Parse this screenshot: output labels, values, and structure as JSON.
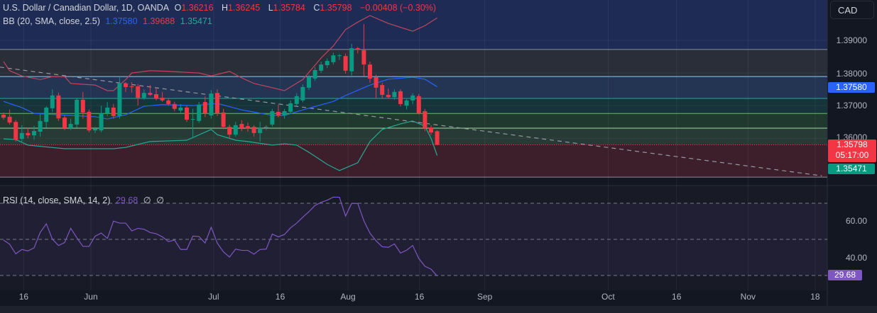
{
  "legend": {
    "symbol": "U.S. Dollar / Canadian Dollar, 1D, OANDA",
    "o_label": "O",
    "o": "1.36216",
    "h_label": "H",
    "h": "1.36245",
    "l_label": "L",
    "l": "1.35784",
    "c_label": "C",
    "c": "1.35798",
    "change": "−0.00408 (−0.30%)",
    "bb_label": "BB (20, SMA, close, 2.5)",
    "bb_basis": "1.37580",
    "bb_upper": "1.39688",
    "bb_lower": "1.35471",
    "rsi_label": "RSI (14, close, SMA, 14, 2)",
    "rsi_value": "29.68",
    "rsi_na1": "∅",
    "rsi_na2": "∅"
  },
  "currency_button": "CAD",
  "price_axis": [
    "1.39000",
    "1.38000",
    "1.37000",
    "1.36000"
  ],
  "rsi_axis": [
    "60.00",
    "40.00"
  ],
  "badges": {
    "basis": "1.37580",
    "last": "1.35798",
    "countdown": "05:17:00",
    "lower": "1.35471",
    "rsi": "29.68"
  },
  "colors": {
    "up": "#089981",
    "down": "#f23645",
    "bb_upper": "#c2455f",
    "bb_basis": "#2962ff",
    "bb_lower": "#22ab94",
    "rsi": "#7e57c2",
    "background": "#131722"
  },
  "chart_data": [
    {
      "type": "candlestick",
      "title": "U.S. Dollar / Canadian Dollar, 1D, OANDA",
      "ylim": [
        1.3455,
        1.3995
      ],
      "grid": true,
      "x_ticks": [
        {
          "label": "16",
          "bar": 3.3
        },
        {
          "label": "Jun",
          "bar": 14.3
        },
        {
          "label": "Jul",
          "bar": 34.4
        },
        {
          "label": "16",
          "bar": 45.3
        },
        {
          "label": "Aug",
          "bar": 56.4
        },
        {
          "label": "16",
          "bar": 68.1
        },
        {
          "label": "Sep",
          "bar": 78.8
        },
        {
          "label": "Oct",
          "bar": 99
        },
        {
          "label": "16",
          "bar": 110.2
        },
        {
          "label": "Nov",
          "bar": 121.9
        },
        {
          "label": "18",
          "bar": 132.9
        }
      ],
      "ohlc": [
        [
          1.3672,
          1.3679,
          1.3657,
          1.3663
        ],
        [
          1.3666,
          1.3688,
          1.3642,
          1.3648
        ],
        [
          1.365,
          1.3656,
          1.359,
          1.3596
        ],
        [
          1.3598,
          1.364,
          1.359,
          1.3616
        ],
        [
          1.3616,
          1.3633,
          1.36,
          1.3609
        ],
        [
          1.3609,
          1.3638,
          1.3596,
          1.3622
        ],
        [
          1.362,
          1.3676,
          1.3605,
          1.3653
        ],
        [
          1.365,
          1.3698,
          1.3632,
          1.3694
        ],
        [
          1.3692,
          1.375,
          1.368,
          1.3731
        ],
        [
          1.3731,
          1.374,
          1.3653,
          1.3661
        ],
        [
          1.3663,
          1.367,
          1.3625,
          1.3631
        ],
        [
          1.3631,
          1.366,
          1.3625,
          1.3644
        ],
        [
          1.3642,
          1.3724,
          1.3632,
          1.3718
        ],
        [
          1.3718,
          1.3742,
          1.366,
          1.3679
        ],
        [
          1.3681,
          1.3688,
          1.3618,
          1.3624
        ],
        [
          1.3624,
          1.3635,
          1.3616,
          1.3629
        ],
        [
          1.3624,
          1.37,
          1.3618,
          1.3676
        ],
        [
          1.3676,
          1.3711,
          1.3668,
          1.3694
        ],
        [
          1.3694,
          1.3705,
          1.366,
          1.3668
        ],
        [
          1.3668,
          1.3789,
          1.366,
          1.3768
        ],
        [
          1.3768,
          1.3772,
          1.3742,
          1.3757
        ],
        [
          1.3759,
          1.3772,
          1.374,
          1.3757
        ],
        [
          1.3759,
          1.3766,
          1.37,
          1.3724
        ],
        [
          1.3724,
          1.375,
          1.3718,
          1.3739
        ],
        [
          1.3739,
          1.3763,
          1.373,
          1.3733
        ],
        [
          1.3735,
          1.3755,
          1.3716,
          1.3722
        ],
        [
          1.3724,
          1.3742,
          1.3712,
          1.3716
        ],
        [
          1.3716,
          1.3722,
          1.37,
          1.3705
        ],
        [
          1.3705,
          1.3712,
          1.3683,
          1.369
        ],
        [
          1.3685,
          1.3705,
          1.3678,
          1.3694
        ],
        [
          1.3694,
          1.37,
          1.365,
          1.3657
        ],
        [
          1.3657,
          1.369,
          1.36,
          1.3659
        ],
        [
          1.3653,
          1.3711,
          1.3647,
          1.3703
        ],
        [
          1.3711,
          1.3728,
          1.3665,
          1.3676
        ],
        [
          1.367,
          1.3748,
          1.366,
          1.3737
        ],
        [
          1.3739,
          1.375,
          1.3668,
          1.3676
        ],
        [
          1.3679,
          1.369,
          1.3628,
          1.3635
        ],
        [
          1.3635,
          1.3642,
          1.36,
          1.3611
        ],
        [
          1.3611,
          1.365,
          1.3605,
          1.364
        ],
        [
          1.3644,
          1.3655,
          1.3622,
          1.3631
        ],
        [
          1.3637,
          1.3648,
          1.362,
          1.3629
        ],
        [
          1.3635,
          1.364,
          1.3605,
          1.3616
        ],
        [
          1.3616,
          1.365,
          1.359,
          1.3631
        ],
        [
          1.3633,
          1.364,
          1.3625,
          1.3635
        ],
        [
          1.3642,
          1.369,
          1.3636,
          1.3683
        ],
        [
          1.3681,
          1.3703,
          1.3664,
          1.367
        ],
        [
          1.367,
          1.369,
          1.366,
          1.3683
        ],
        [
          1.3681,
          1.3716,
          1.3674,
          1.3707
        ],
        [
          1.3705,
          1.3738,
          1.3698,
          1.3729
        ],
        [
          1.3716,
          1.3765,
          1.371,
          1.3757
        ],
        [
          1.3755,
          1.3795,
          1.3748,
          1.3787
        ],
        [
          1.3783,
          1.3818,
          1.3776,
          1.3809
        ],
        [
          1.3807,
          1.3835,
          1.38,
          1.3826
        ],
        [
          1.3824,
          1.3845,
          1.3815,
          1.3837
        ],
        [
          1.3833,
          1.3862,
          1.3826,
          1.3854
        ],
        [
          1.3852,
          1.3858,
          1.384,
          1.3854
        ],
        [
          1.3852,
          1.386,
          1.3798,
          1.3807
        ],
        [
          1.3805,
          1.3889,
          1.3792,
          1.3876
        ],
        [
          1.3876,
          1.388,
          1.386,
          1.3874
        ],
        [
          1.387,
          1.395,
          1.379,
          1.3826
        ],
        [
          1.3826,
          1.3835,
          1.377,
          1.3783
        ],
        [
          1.3787,
          1.3795,
          1.3722,
          1.3755
        ],
        [
          1.3763,
          1.377,
          1.3722,
          1.3733
        ],
        [
          1.3733,
          1.3752,
          1.3722,
          1.3726
        ],
        [
          1.3726,
          1.375,
          1.3718,
          1.3742
        ],
        [
          1.3744,
          1.375,
          1.3698,
          1.3705
        ],
        [
          1.37,
          1.372,
          1.3688,
          1.3716
        ],
        [
          1.3716,
          1.3738,
          1.3705,
          1.3731
        ],
        [
          1.3729,
          1.3736,
          1.3672,
          1.3676
        ],
        [
          1.3683,
          1.369,
          1.3622,
          1.3631
        ],
        [
          1.3633,
          1.364,
          1.361,
          1.3618
        ],
        [
          1.36216,
          1.36245,
          1.35784,
          1.35798
        ]
      ],
      "bollinger": {
        "upper": [
          [
            0,
            1.3835
          ],
          [
            1,
            1.3807
          ],
          [
            3,
            1.3791
          ],
          [
            6,
            1.378
          ],
          [
            8,
            1.3789
          ],
          [
            10,
            1.3789
          ],
          [
            11,
            1.3768
          ],
          [
            15,
            1.3763
          ],
          [
            17,
            1.3746
          ],
          [
            18,
            1.3746
          ],
          [
            20,
            1.378
          ],
          [
            21,
            1.38
          ],
          [
            24,
            1.3807
          ],
          [
            27,
            1.3805
          ],
          [
            32,
            1.38
          ],
          [
            34,
            1.3791
          ],
          [
            37,
            1.3805
          ],
          [
            39,
            1.3785
          ],
          [
            41,
            1.3768
          ],
          [
            44,
            1.3755
          ],
          [
            46,
            1.3746
          ],
          [
            49,
            1.378
          ],
          [
            52,
            1.3846
          ],
          [
            54,
            1.3883
          ],
          [
            56,
            1.3933
          ],
          [
            58,
            1.3956
          ],
          [
            60,
            1.3976
          ],
          [
            63,
            1.3952
          ],
          [
            67,
            1.3928
          ],
          [
            69,
            1.3945
          ],
          [
            71,
            1.39688
          ]
        ],
        "basis": [
          [
            0,
            1.3713
          ],
          [
            3,
            1.3694
          ],
          [
            5,
            1.3676
          ],
          [
            11,
            1.367
          ],
          [
            15,
            1.3666
          ],
          [
            17,
            1.3659
          ],
          [
            20,
            1.3672
          ],
          [
            23,
            1.3698
          ],
          [
            26,
            1.3703
          ],
          [
            31,
            1.37
          ],
          [
            35,
            1.3707
          ],
          [
            39,
            1.3687
          ],
          [
            44,
            1.367
          ],
          [
            46,
            1.367
          ],
          [
            49,
            1.3687
          ],
          [
            54,
            1.3713
          ],
          [
            56,
            1.3731
          ],
          [
            60,
            1.3763
          ],
          [
            63,
            1.3781
          ],
          [
            67,
            1.3787
          ],
          [
            69,
            1.3781
          ],
          [
            71,
            1.3758
          ]
        ],
        "lower": [
          [
            0,
            1.3598
          ],
          [
            2,
            1.3596
          ],
          [
            4,
            1.3579
          ],
          [
            10,
            1.3568
          ],
          [
            15,
            1.3568
          ],
          [
            18,
            1.3568
          ],
          [
            20,
            1.3572
          ],
          [
            24,
            1.359
          ],
          [
            30,
            1.3594
          ],
          [
            34,
            1.3627
          ],
          [
            35,
            1.3611
          ],
          [
            38,
            1.3594
          ],
          [
            40,
            1.359
          ],
          [
            44,
            1.3579
          ],
          [
            46,
            1.3583
          ],
          [
            48,
            1.3579
          ],
          [
            50,
            1.3557
          ],
          [
            53,
            1.352
          ],
          [
            55,
            1.3501
          ],
          [
            58,
            1.3525
          ],
          [
            60,
            1.359
          ],
          [
            62,
            1.3627
          ],
          [
            65,
            1.3644
          ],
          [
            67,
            1.3653
          ],
          [
            69,
            1.3637
          ],
          [
            70,
            1.36
          ],
          [
            71,
            1.35471
          ]
        ]
      },
      "horizontal_levels": [
        1.3872,
        1.3789,
        1.3722,
        1.3676,
        1.3631,
        1.35798,
        1.3481
      ],
      "trendline": [
        [
          -0.6,
          1.3818
        ],
        [
          134,
          1.3485
        ]
      ]
    },
    {
      "type": "line",
      "title": "RSI (14, close, SMA, 14, 2)",
      "ylim": [
        20,
        80
      ],
      "bands": [
        70,
        50,
        30
      ],
      "values": [
        49.6,
        47.3,
        42.0,
        44.4,
        43.6,
        45.3,
        53.8,
        58.6,
        50.1,
        46.6,
        48.2,
        56.1,
        50.9,
        46.1,
        46.1,
        51.8,
        53.5,
        50.5,
        60.1,
        59.0,
        59.0,
        54.7,
        56.1,
        55.6,
        53.8,
        53.1,
        51.4,
        48.8,
        49.6,
        44.4,
        44.4,
        51.8,
        51.6,
        48.0,
        56.7,
        47.9,
        43.1,
        40.2,
        44.6,
        43.9,
        43.9,
        41.8,
        44.4,
        44.6,
        52.9,
        51.4,
        52.7,
        56.4,
        59.0,
        62.3,
        65.3,
        68.8,
        70.5,
        71.7,
        73.4,
        73.3,
        62.9,
        69.9,
        69.9,
        60.3,
        53.4,
        49.2,
        45.9,
        45.6,
        47.5,
        42.4,
        44.0,
        46.6,
        39.4,
        35.1,
        33.5,
        29.68
      ]
    }
  ]
}
